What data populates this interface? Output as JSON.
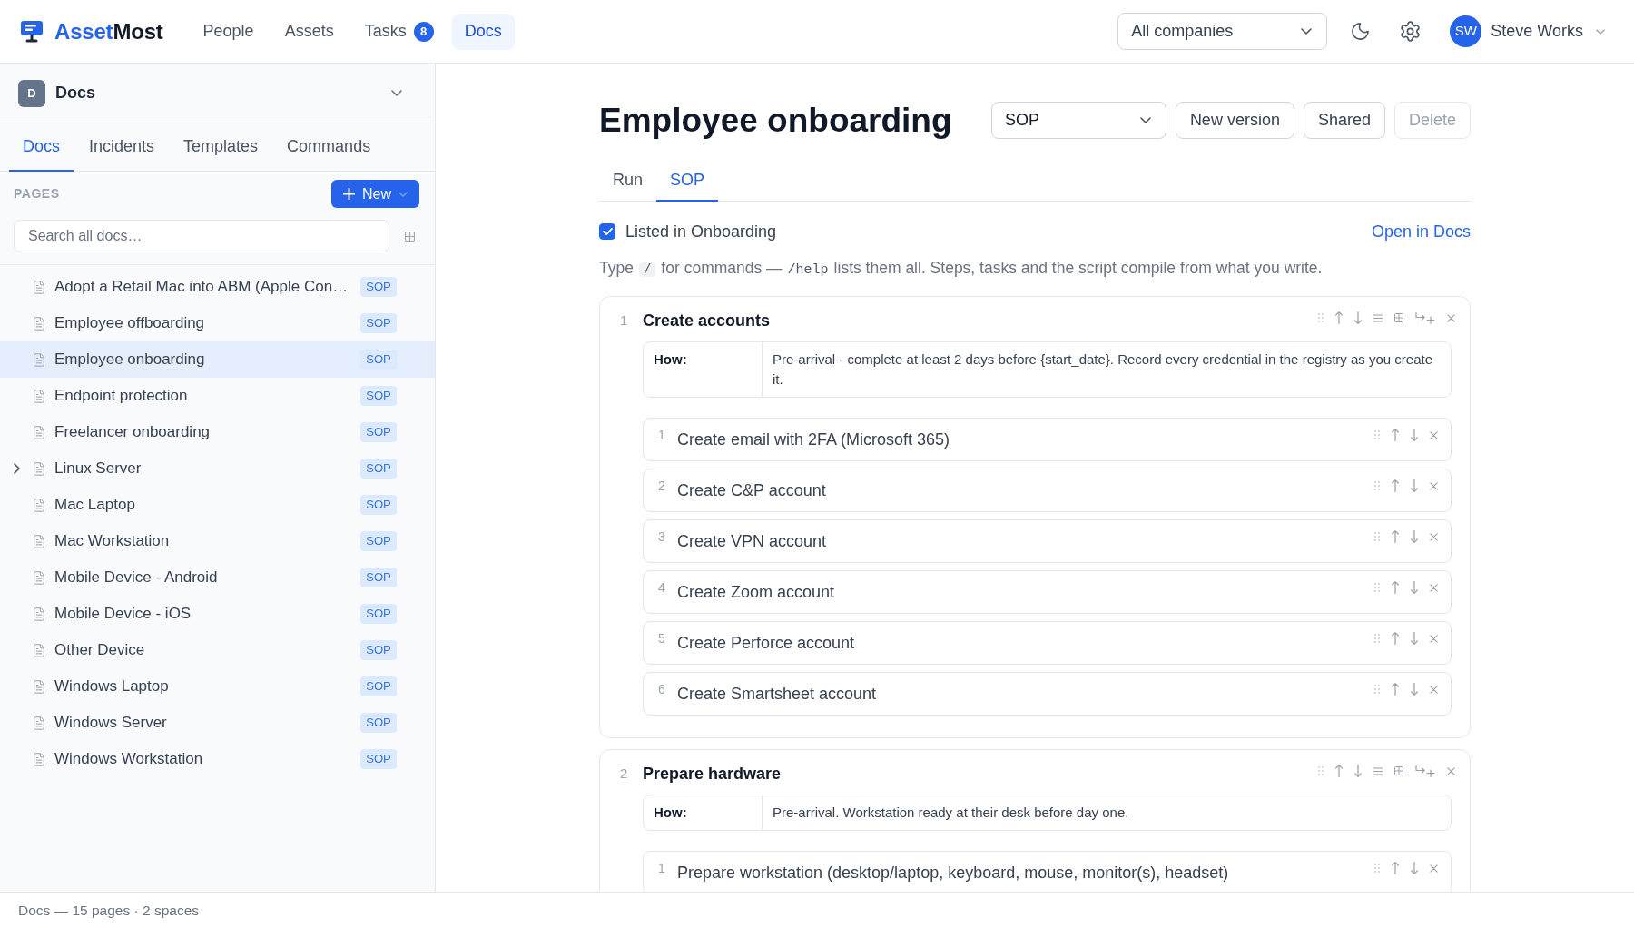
{
  "topbar": {
    "logo": {
      "first": "Asset",
      "second": "Most"
    },
    "nav": [
      {
        "label": "People",
        "selected": false
      },
      {
        "label": "Assets",
        "selected": false
      },
      {
        "label": "Tasks",
        "badge": "8",
        "selected": false
      },
      {
        "label": "Docs",
        "selected": true
      }
    ],
    "company_select": {
      "value": "All companies"
    },
    "user": {
      "initials": "SW",
      "name": "Steve Works"
    }
  },
  "sidebar": {
    "space": {
      "initial": "D",
      "name": "Docs"
    },
    "tabs": [
      {
        "label": "Docs",
        "selected": true
      },
      {
        "label": "Incidents",
        "selected": false
      },
      {
        "label": "Templates",
        "selected": false
      },
      {
        "label": "Commands",
        "selected": false
      }
    ],
    "section_label": "PAGES",
    "new_button": {
      "label": "New"
    },
    "search": {
      "placeholder": "Search all docs…"
    },
    "pages": [
      {
        "title": "Adopt a Retail Mac into ABM (Apple Con…",
        "tag": "SOP",
        "selected": false,
        "expandable": false
      },
      {
        "title": "Employee offboarding",
        "tag": "SOP",
        "selected": false,
        "expandable": false
      },
      {
        "title": "Employee onboarding",
        "tag": "SOP",
        "selected": true,
        "expandable": false
      },
      {
        "title": "Endpoint protection",
        "tag": "SOP",
        "selected": false,
        "expandable": false
      },
      {
        "title": "Freelancer onboarding",
        "tag": "SOP",
        "selected": false,
        "expandable": false
      },
      {
        "title": "Linux Server",
        "tag": "SOP",
        "selected": false,
        "expandable": true
      },
      {
        "title": "Mac Laptop",
        "tag": "SOP",
        "selected": false,
        "expandable": false
      },
      {
        "title": "Mac Workstation",
        "tag": "SOP",
        "selected": false,
        "expandable": false
      },
      {
        "title": "Mobile Device - Android",
        "tag": "SOP",
        "selected": false,
        "expandable": false
      },
      {
        "title": "Mobile Device - iOS",
        "tag": "SOP",
        "selected": false,
        "expandable": false
      },
      {
        "title": "Other Device",
        "tag": "SOP",
        "selected": false,
        "expandable": false
      },
      {
        "title": "Windows Laptop",
        "tag": "SOP",
        "selected": false,
        "expandable": false
      },
      {
        "title": "Windows Server",
        "tag": "SOP",
        "selected": false,
        "expandable": false
      },
      {
        "title": "Windows Workstation",
        "tag": "SOP",
        "selected": false,
        "expandable": false
      }
    ]
  },
  "document": {
    "title": "Employee onboarding",
    "type_select": {
      "value": "SOP"
    },
    "actions": [
      {
        "label": "New version",
        "disabled": false
      },
      {
        "label": "Shared",
        "disabled": false
      },
      {
        "label": "Delete",
        "disabled": true
      }
    ],
    "tabs": [
      {
        "label": "Run",
        "selected": false
      },
      {
        "label": "SOP",
        "selected": true
      }
    ],
    "listed": {
      "label": "Listed in Onboarding",
      "checked": true
    },
    "open_link": "Open in Docs",
    "hint": [
      {
        "kind": "text",
        "text": "Type"
      },
      {
        "kind": "key",
        "text": "/"
      },
      {
        "kind": "text",
        "text": "for commands —"
      },
      {
        "kind": "code",
        "text": "/help"
      },
      {
        "kind": "text",
        "text": "lists them all. Steps, tasks and the script compile from what you write."
      }
    ],
    "steps": [
      {
        "number": "1",
        "title": "Create accounts",
        "how": {
          "label": "How:",
          "text": "Pre-arrival - complete at least 2 days before {start_date}. Record every credential in the registry as you create it."
        },
        "substeps": [
          {
            "number": "1",
            "text": "Create email with 2FA (Microsoft 365)"
          },
          {
            "number": "2",
            "text": "Create C&P account"
          },
          {
            "number": "3",
            "text": "Create VPN account"
          },
          {
            "number": "4",
            "text": "Create Zoom account"
          },
          {
            "number": "5",
            "text": "Create Perforce account"
          },
          {
            "number": "6",
            "text": "Create Smartsheet account"
          }
        ]
      },
      {
        "number": "2",
        "title": "Prepare hardware",
        "how": {
          "label": "How:",
          "text": "Pre-arrival. Workstation ready at their desk before day one."
        },
        "substeps": [
          {
            "number": "1",
            "text": "Prepare workstation (desktop/laptop, keyboard, mouse, monitor(s), headset)"
          }
        ]
      }
    ]
  },
  "status_bar": {
    "text": "Docs — 15 pages · 2 spaces"
  }
}
